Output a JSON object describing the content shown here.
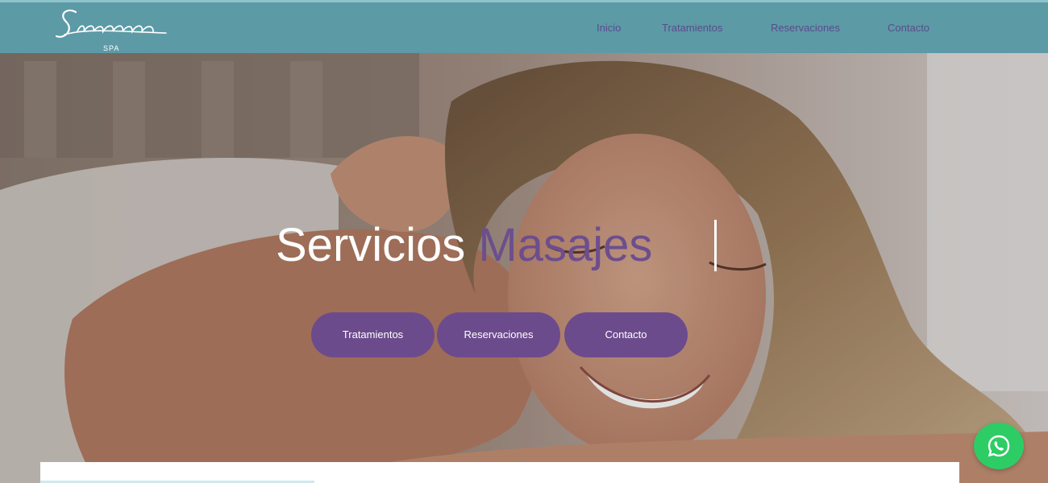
{
  "header": {
    "logo_text": "Sansara",
    "logo_sub": "SPA",
    "nav": [
      "Inicio",
      "Tratamientos",
      "Reservaciones",
      "Contacto"
    ]
  },
  "hero": {
    "title_static": "Servicios",
    "title_typed": "Masajes",
    "buttons": [
      "Tratamientos",
      "Reservaciones",
      "Contacto"
    ]
  },
  "icons": {
    "whatsapp": "whatsapp-icon"
  },
  "colors": {
    "header": "#5c9aa6",
    "accent_purple": "#6c4b8c",
    "whatsapp_green": "#2ecc65"
  }
}
